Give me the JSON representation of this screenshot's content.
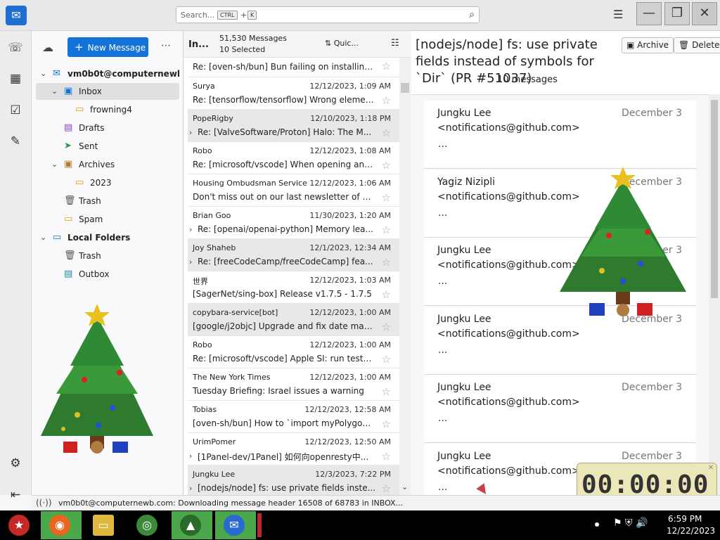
{
  "titlebar": {
    "search_placeholder": "Search...",
    "kbd_ctrl": "CTRL",
    "kbd_plus": "+",
    "kbd_k": "K"
  },
  "spaces": {
    "icons": [
      "mail-icon",
      "address-book-icon",
      "calendar-icon",
      "tasks-icon",
      "chat-icon",
      "settings-icon",
      "collapse-icon"
    ]
  },
  "folder_pane": {
    "new_message": "New Message",
    "account": "vm0b0t@computernewb...",
    "folders": {
      "inbox": "Inbox",
      "frowning4": "frowning4",
      "drafts": "Drafts",
      "sent": "Sent",
      "archives": "Archives",
      "y2023": "2023",
      "trash": "Trash",
      "spam": "Spam",
      "local": "Local Folders",
      "local_trash": "Trash",
      "outbox": "Outbox"
    }
  },
  "list": {
    "folder": "In...",
    "count": "51,530 Messages",
    "selected": "10 Selected",
    "quick_filter": "Quic...",
    "messages": [
      {
        "sender": "",
        "date": "",
        "subject": "Re: [oven-sh/bun] Bun failing on installing ..."
      },
      {
        "sender": "Surya",
        "date": "12/12/2023, 1:09 AM",
        "subject": "Re: [tensorflow/tensorflow] Wrong elemen..."
      },
      {
        "sender": "PopeRigby",
        "date": "12/10/2023, 1:18 PM",
        "subject": "Re: [ValveSoftware/Proton] Halo: The M..."
      },
      {
        "sender": "Robo",
        "date": "12/12/2023, 1:08 AM",
        "subject": "Re: [microsoft/vscode] When opening and ..."
      },
      {
        "sender": "Housing Ombudsman Service",
        "date": "12/12/2023, 1:06 AM",
        "subject": "Don't miss out on our last newsletter of th..."
      },
      {
        "sender": "Brian Goo",
        "date": "11/30/2023, 1:20 AM",
        "subject": "Re: [openai/openai-python] Memory lea..."
      },
      {
        "sender": "Joy Shaheb",
        "date": "12/1/2023, 12:34 AM",
        "subject": "Re: [freeCodeCamp/freeCodeCamp] fea..."
      },
      {
        "sender": "世界",
        "date": "12/12/2023, 1:03 AM",
        "subject": "[SagerNet/sing-box] Release v1.7.5 - 1.7.5"
      },
      {
        "sender": "copybara-service[bot]",
        "date": "12/12/2023, 1:00 AM",
        "subject": "[google/j2objc] Upgrade and fix date mat..."
      },
      {
        "sender": "Robo",
        "date": "12/12/2023, 1:00 AM",
        "subject": "Re: [microsoft/vscode] Apple SI: run tests (..."
      },
      {
        "sender": "The New York Times",
        "date": "12/12/2023, 1:00 AM",
        "subject": "Tuesday Briefing: Israel issues a warning"
      },
      {
        "sender": "Tobias",
        "date": "12/12/2023, 12:58 AM",
        "subject": "[oven-sh/bun] How to `import myPolygon f..."
      },
      {
        "sender": "UrimPomer",
        "date": "12/12/2023, 12:50 AM",
        "subject": "[1Panel-dev/1Panel] 如何向openresty中..."
      },
      {
        "sender": "Jungku Lee",
        "date": "12/3/2023, 7:22 PM",
        "subject": "[nodejs/node] fs: use private fields inste..."
      }
    ]
  },
  "reader": {
    "subject": "[nodejs/node] fs: use private fields instead of symbols for `Dir` (PR #51037)",
    "count": "10 messages",
    "archive": "Archive",
    "delete": "Delete",
    "cards": [
      {
        "name": "Jungku Lee",
        "email": "<notifications@github.com>",
        "date": "December 3",
        "preview": "..."
      },
      {
        "name": "Yagiz Nizipli",
        "email": "<notifications@github.com>",
        "date": "December 3",
        "preview": "..."
      },
      {
        "name": "Jungku Lee",
        "email": "<notifications@github.com>",
        "date": "December 3",
        "preview": "..."
      },
      {
        "name": "Jungku Lee",
        "email": "<notifications@github.com>",
        "date": "December 3",
        "preview": "..."
      },
      {
        "name": "Jungku Lee",
        "email": "<notifications@github.com>",
        "date": "December 3",
        "preview": "..."
      },
      {
        "name": "Jungku Lee",
        "email": "<notifications@github.com>",
        "date": "December 3",
        "preview": "..."
      }
    ]
  },
  "timer": {
    "display": "00:00:00"
  },
  "status": {
    "text": "vm0b0t@computernewb.com: Downloading message header 16508 of 68783 in INBOX..."
  },
  "taskbar": {
    "time": "6:59 PM",
    "date": "12/22/2023",
    "apps": [
      "santa-start-icon",
      "firefox-icon",
      "file-explorer-icon",
      "chrome-icon",
      "christmas-tree-icon",
      "thunderbird-icon"
    ]
  },
  "colors": {
    "accent": "#1373d9",
    "taskbar_active": "#4aa84a",
    "timer_bg": "#ece7b8"
  }
}
